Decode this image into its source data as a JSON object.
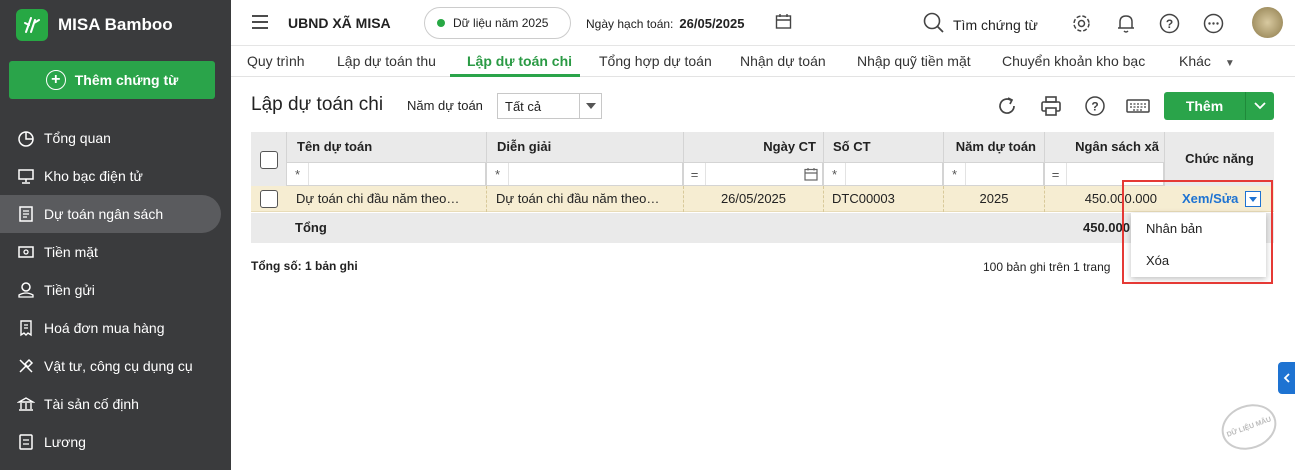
{
  "app": {
    "name": "MISA Bamboo",
    "add_button": "Thêm chứng từ"
  },
  "sidebar": {
    "items": [
      {
        "label": "Tổng quan",
        "icon": "pie-chart-icon"
      },
      {
        "label": "Kho bạc điện tử",
        "icon": "monitor-icon"
      },
      {
        "label": "Dự toán ngân sách",
        "icon": "budget-icon",
        "active": true
      },
      {
        "label": "Tiền mặt",
        "icon": "cash-icon"
      },
      {
        "label": "Tiền gửi",
        "icon": "deposit-icon"
      },
      {
        "label": "Hoá đơn mua hàng",
        "icon": "invoice-icon"
      },
      {
        "label": "Vật tư, công cụ dụng cụ",
        "icon": "tools-icon"
      },
      {
        "label": "Tài sản cố định",
        "icon": "bank-icon"
      },
      {
        "label": "Lương",
        "icon": "salary-icon"
      }
    ]
  },
  "header": {
    "org": "UBND XÃ MISA",
    "data_year": "Dữ liệu năm 2025",
    "posting_date_label": "Ngày hạch toán:",
    "posting_date": "26/05/2025",
    "search": "Tìm chứng từ"
  },
  "tabs": [
    "Quy trình",
    "Lập dự toán thu",
    "Lập dự toán chi",
    "Tổng hợp dự toán",
    "Nhận dự toán",
    "Nhập quỹ tiền mặt",
    "Chuyển khoản kho bạc",
    "Khác"
  ],
  "active_tab": "Lập dự toán chi",
  "page": {
    "title": "Lập dự toán chi",
    "year_label": "Năm dự toán",
    "year_value": "Tất cả",
    "add_label": "Thêm"
  },
  "table": {
    "columns": [
      "Tên dự toán",
      "Diễn giải",
      "Ngày CT",
      "Số CT",
      "Năm dự toán",
      "Ngân sách xã",
      "Chức năng"
    ],
    "filter_ops": [
      "*",
      "*",
      "=",
      "*",
      "*",
      "="
    ],
    "rows": [
      {
        "ten": "Dự toán chi đầu năm theo…",
        "dien_giai": "Dự toán chi đầu năm theo…",
        "ngay": "26/05/2025",
        "so": "DTC00003",
        "nam": "2025",
        "ngan_sach": "450.000.000",
        "action": "Xem/Sửa"
      }
    ],
    "total_label": "Tổng",
    "total_value": "450.000"
  },
  "menu": [
    "Nhân bản",
    "Xóa"
  ],
  "footer": {
    "count": "Tổng số: 1 bản ghi",
    "paging": "100 bản ghi trên 1 trang"
  },
  "stamp": "DỮ LIỆU MẪU",
  "colors": {
    "accent": "#2aa44a",
    "sidebar": "#3a3b3d",
    "link": "#1e73d2",
    "highlight_row": "#f6edd2",
    "annotation": "#e53935"
  }
}
